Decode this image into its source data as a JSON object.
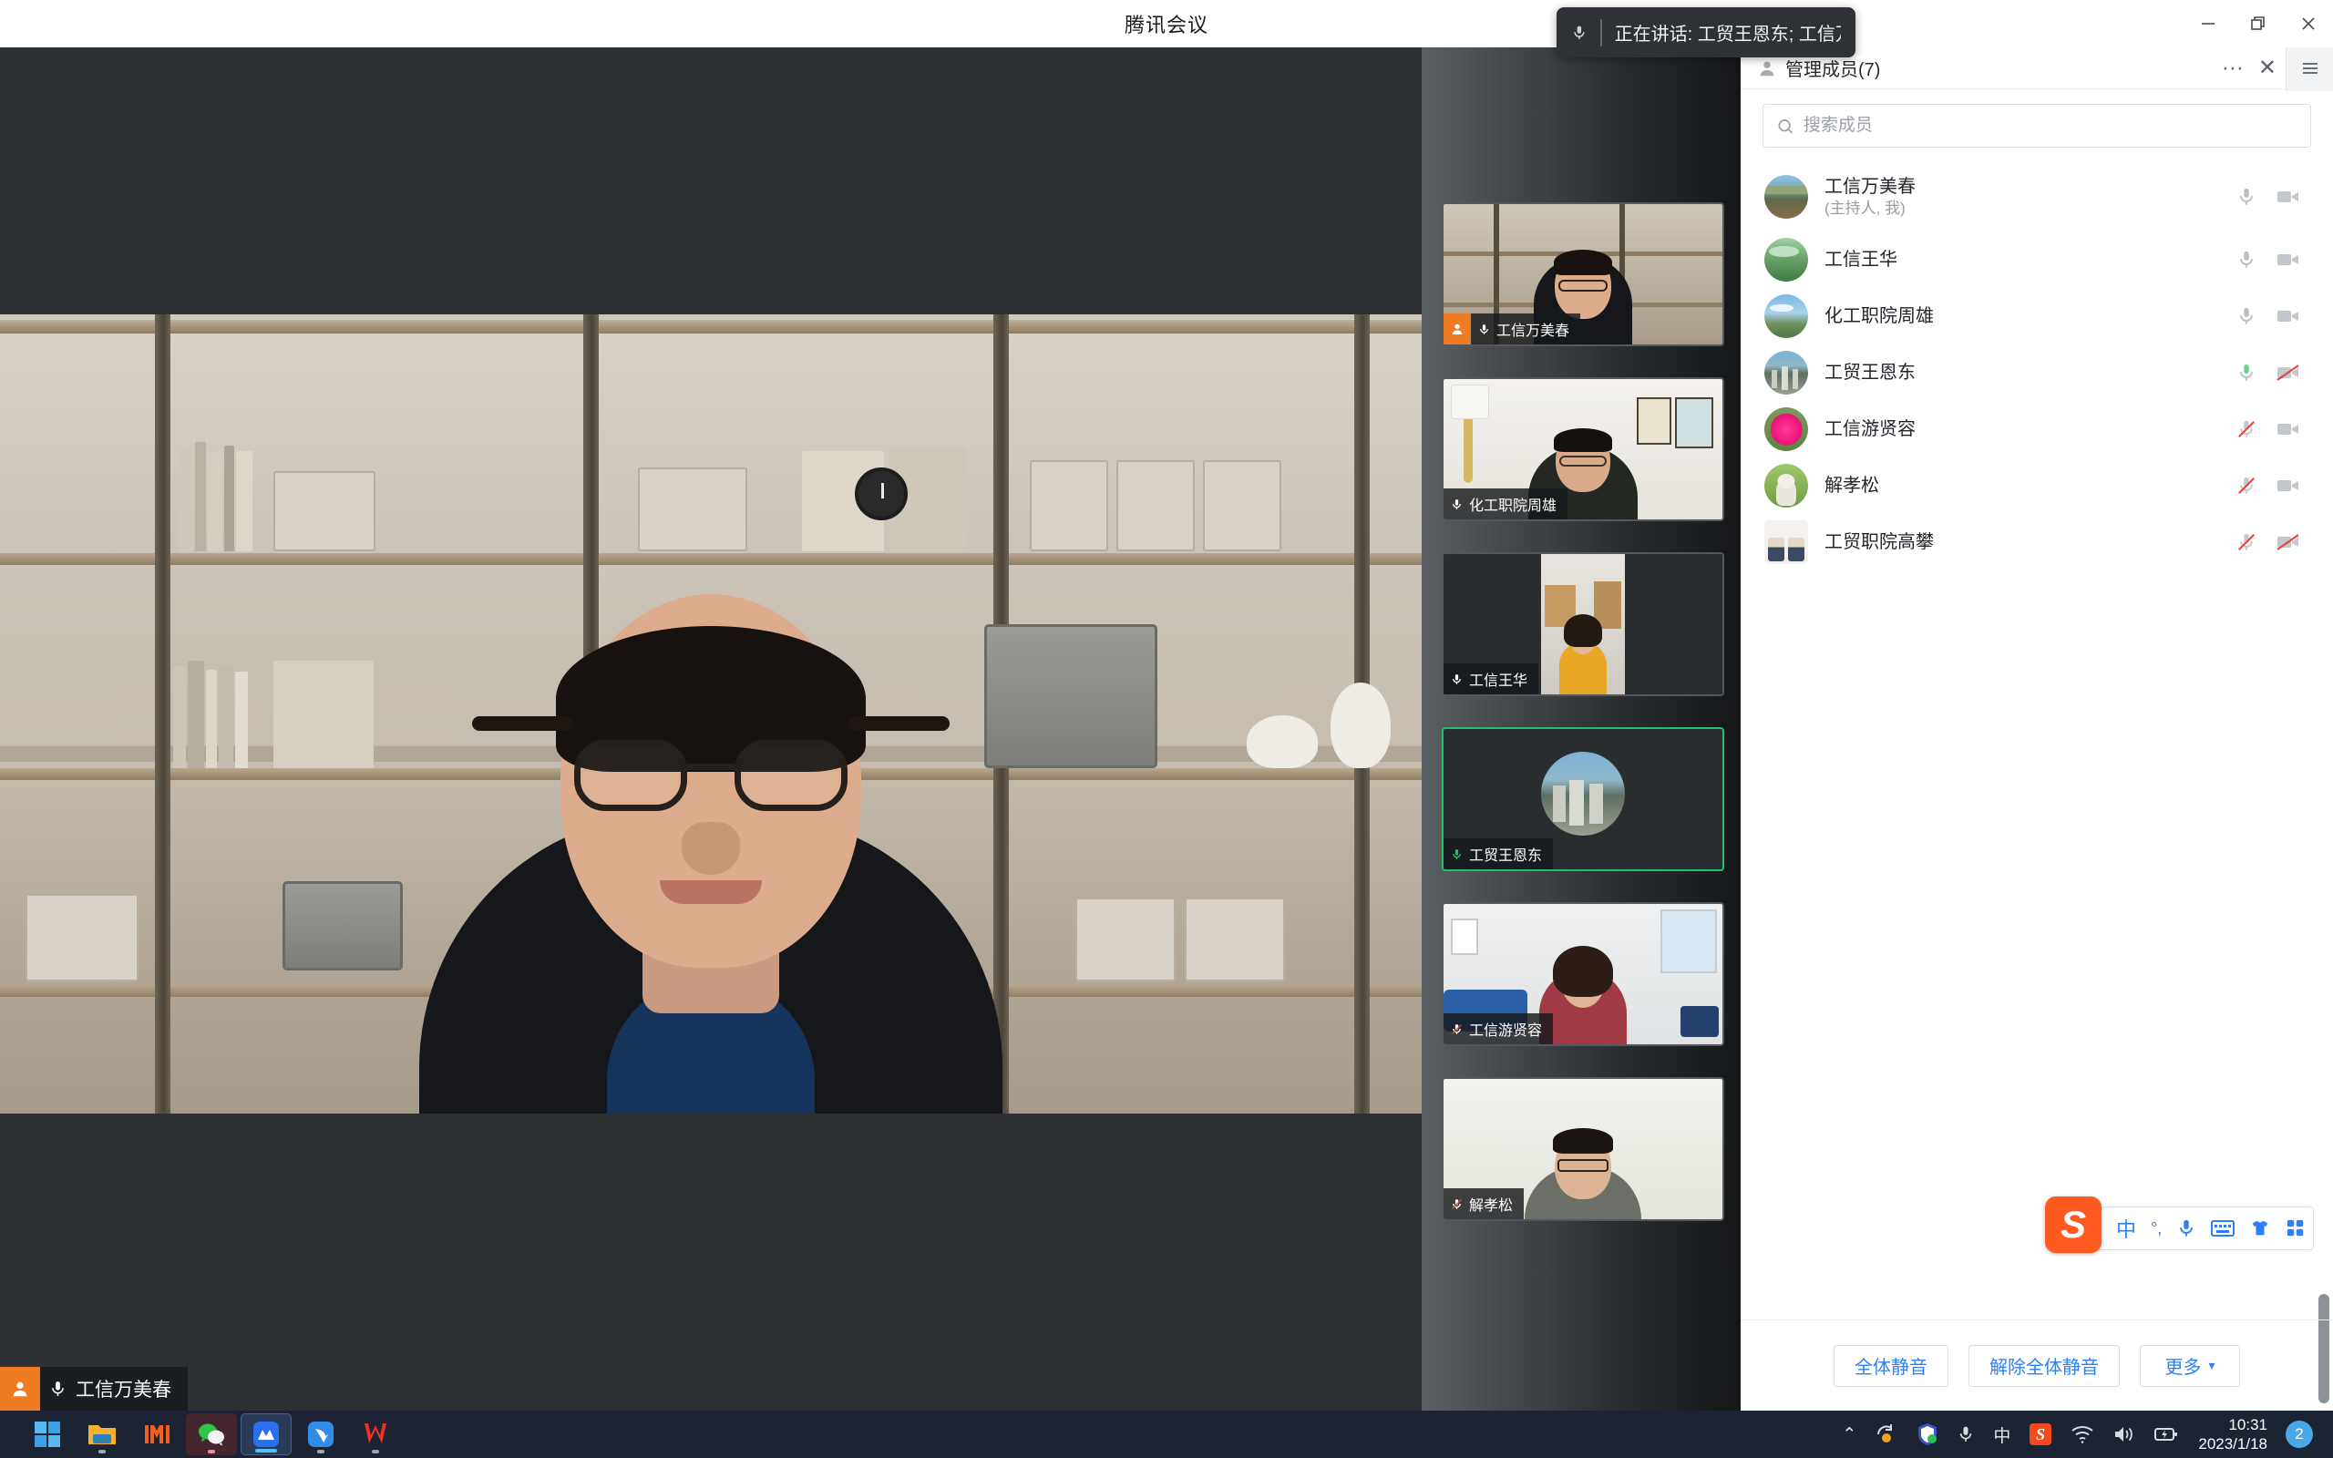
{
  "window": {
    "title": "腾讯会议",
    "controls": {
      "minimize": "minimize-icon",
      "restore": "restore-icon",
      "close": "close-icon"
    }
  },
  "toast": {
    "icon": "microphone-icon",
    "text": "正在讲话: 工贸王恩东; 工信万..."
  },
  "main_video": {
    "name": "工信万美春",
    "host_badge": "host-icon",
    "mic_state": "unmuted",
    "mic_icon": "microphone-icon"
  },
  "filmstrip": [
    {
      "name": "工信万美春",
      "host": true,
      "mic": "unmuted",
      "active": false,
      "kind": "video",
      "avatar": "city"
    },
    {
      "name": "化工职院周雄",
      "host": false,
      "mic": "unmuted",
      "active": false,
      "kind": "video",
      "avatar": "lake"
    },
    {
      "name": "工信王华",
      "host": false,
      "mic": "unmuted",
      "active": false,
      "kind": "video",
      "avatar": "lotus"
    },
    {
      "name": "工贸王恩东",
      "host": false,
      "mic": "speaking",
      "active": true,
      "kind": "avatar",
      "avatar": "city"
    },
    {
      "name": "工信游贤容",
      "host": false,
      "mic": "muted",
      "active": false,
      "kind": "video",
      "avatar": "flower"
    },
    {
      "name": "解孝松",
      "host": false,
      "mic": "muted",
      "active": false,
      "kind": "video",
      "avatar": "cat"
    }
  ],
  "panel": {
    "header": {
      "icon": "person-icon",
      "title": "管理成员(7)",
      "more": "···",
      "close": "✕",
      "menu": "hamburger-icon"
    },
    "search": {
      "icon": "search-icon",
      "placeholder": "搜索成员",
      "value": ""
    },
    "participants": [
      {
        "name": "工信万美春",
        "role": "(主持人, 我)",
        "mic": "unmuted",
        "camera": "on",
        "avatar": "mountain"
      },
      {
        "name": "工信王华",
        "role": "",
        "mic": "unmuted",
        "camera": "on",
        "avatar": "lotus"
      },
      {
        "name": "化工职院周雄",
        "role": "",
        "mic": "unmuted",
        "camera": "on",
        "avatar": "sky"
      },
      {
        "name": "工贸王恩东",
        "role": "",
        "mic": "speaking",
        "camera": "off",
        "avatar": "city"
      },
      {
        "name": "工信游贤容",
        "role": "",
        "mic": "muted",
        "camera": "on",
        "avatar": "flower"
      },
      {
        "name": "解孝松",
        "role": "",
        "mic": "muted",
        "camera": "on",
        "avatar": "cat"
      },
      {
        "name": "工贸职院高攀",
        "role": "",
        "mic": "muted",
        "camera": "off",
        "avatar": "photo"
      }
    ],
    "footer": {
      "mute_all": "全体静音",
      "unmute_all": "解除全体静音",
      "more": "更多",
      "more_caret": "▾"
    }
  },
  "ime": {
    "logo": "S",
    "mode": "中",
    "punctuation": "°,",
    "voice": "microphone-icon",
    "keyboard": "keyboard-icon",
    "skin": "shirt-icon",
    "menu": "grid-icon"
  },
  "taskbar": {
    "items": [
      {
        "name": "start-button",
        "icon": "windows-logo"
      },
      {
        "name": "file-explorer",
        "icon": "folder-icon"
      },
      {
        "name": "mi-app",
        "icon": "mi-logo"
      },
      {
        "name": "wechat",
        "icon": "wechat-logo"
      },
      {
        "name": "tencent-meeting",
        "icon": "tencent-meeting-logo"
      },
      {
        "name": "dingtalk",
        "icon": "dingtalk-logo"
      },
      {
        "name": "wps-office",
        "icon": "wps-logo"
      }
    ],
    "tray": {
      "chevron": "⌃",
      "icons": [
        "sync-icon",
        "security-icon",
        "microphone-icon",
        "ime-mode-icon",
        "sogou-icon",
        "wifi-icon",
        "volume-icon",
        "battery-icon"
      ],
      "ime_mode": "中",
      "time": "10:31",
      "date": "2023/1/18",
      "badge": "2"
    }
  },
  "colors": {
    "accent_blue": "#2d7ff9",
    "host_orange": "#f07b25",
    "speaking_green": "#27c06a",
    "muted_red": "#e8453c",
    "panel_bg": "#ffffff",
    "stage_bg": "#2d3134",
    "taskbar_bg": "#1c2433"
  }
}
